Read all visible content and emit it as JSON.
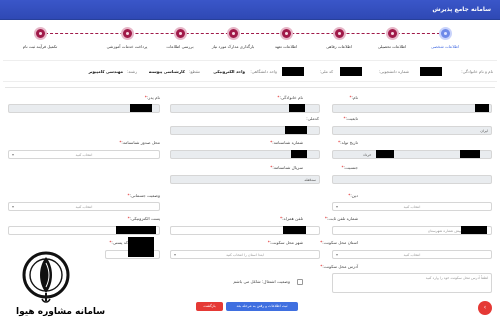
{
  "header": {
    "title": "سامانه جامع پذیرش"
  },
  "stepper": {
    "steps": [
      {
        "label": "اطلاعات شخصی",
        "active": true
      },
      {
        "label": "اطلاعات تحصیلی"
      },
      {
        "label": "اطلاعات رفاهی"
      },
      {
        "label": "اطلاعات تعهد"
      },
      {
        "label": "بارگذاری مدارک مورد نیاز"
      },
      {
        "label": "بررسی اطلاعات"
      },
      {
        "label": "پرداخت خدمات آموزشی"
      },
      {
        "label": "تکمیل فرآیند ثبت نام"
      }
    ]
  },
  "infobar": {
    "name_label": "نام و نام خانوادگی:",
    "student_no_label": "شماره دانشجویی:",
    "national_code_label": "کد ملی:",
    "unit_label": "واحد دانشگاهی:",
    "unit_value": "واحد الکترونیکی",
    "level_label": "مقطع:",
    "level_value": "کارشناسی پیوسته",
    "field_label": "رشته:",
    "field_value": "مهندسی کامپیوتر"
  },
  "form": {
    "first_name": {
      "label": "نام:"
    },
    "last_name": {
      "label": "نام خانوادگی:"
    },
    "father_name": {
      "label": "نام پدر:"
    },
    "nationality": {
      "label": "تابعیت:",
      "value": "ایران"
    },
    "national_code": {
      "label": "کدملی:"
    },
    "birth_date": {
      "label": "تاریخ تولد:",
      "month_value": "خرداد"
    },
    "id_number": {
      "label": "شماره شناسنامه:"
    },
    "issue_place": {
      "label": "محل صدور شناسنامه:",
      "placeholder": "انتخاب کنید"
    },
    "gender": {
      "label": "جنسیت:"
    },
    "id_series": {
      "label": "سریال شناسنامه:",
      "value": "سه‌قفله"
    },
    "religion": {
      "label": "دین:",
      "placeholder": "انتخاب کنید"
    },
    "disability": {
      "label": "وضعیت جسمانی:",
      "placeholder": "انتخاب کنید"
    },
    "landline": {
      "label": "شماره تلفن ثابت:",
      "placeholder": "پیش شماره شهرستان"
    },
    "mobile": {
      "label": "تلفن همراه:"
    },
    "email": {
      "label": "پست الکترونیکی:"
    },
    "province": {
      "label": "استان محل سکونت:",
      "placeholder": "انتخاب کنید"
    },
    "city": {
      "label": "شهر محل سکونت:",
      "placeholder": "ابتدا استان را انتخاب کنید"
    },
    "postal_code": {
      "label": "کد پستی:"
    },
    "address": {
      "label": "آدرس محل سکونت:",
      "placeholder": "لطفاً آدرس محل سکونت خود را وارد کنید"
    },
    "employment": {
      "label": "وضعیت اشتغال: شاغل می باشم"
    }
  },
  "actions": {
    "save_next": "ثبت اطلاعات و رفتن به مرحله بعد",
    "back": "بازگشت"
  },
  "logo": {
    "text": "سامانه مشاوره هیوا"
  },
  "colors": {
    "header": "#3048b8",
    "step": "#a01a49",
    "active_step": "#6f8ae8",
    "save": "#3f6fe0",
    "back": "#e53935"
  }
}
